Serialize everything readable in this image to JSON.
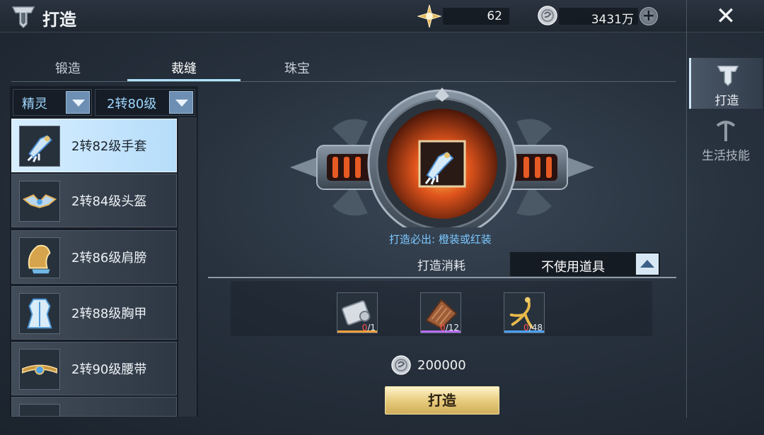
{
  "header": {
    "title": "打造",
    "star_value": "62",
    "silver_value": "3431万"
  },
  "tabs": [
    {
      "label": "锻造"
    },
    {
      "label": "裁缝"
    },
    {
      "label": "珠宝"
    }
  ],
  "filters": {
    "class_label": "精灵",
    "level_label": "2转80级"
  },
  "items": [
    {
      "label": "2转82级手套",
      "icon": "gloves-icon"
    },
    {
      "label": "2转84级头盔",
      "icon": "helmet-icon"
    },
    {
      "label": "2转86级肩膀",
      "icon": "shoulder-icon"
    },
    {
      "label": "2转88级胸甲",
      "icon": "chest-armor-icon"
    },
    {
      "label": "2转90级腰带",
      "icon": "belt-icon"
    }
  ],
  "side_nav": [
    {
      "label": "打造"
    },
    {
      "label": "生活技能"
    }
  ],
  "forge": {
    "note": "打造必出: 橙装或红装",
    "cost_label": "打造消耗",
    "item_select": "不使用道具",
    "materials": [
      {
        "icon": "scroll-icon",
        "owned": "0",
        "needed": "/1",
        "rarity_color": "#f2a03a"
      },
      {
        "icon": "leather-icon",
        "owned": "0",
        "needed": "/12",
        "rarity_color": "#b86cf0"
      },
      {
        "icon": "ginseng-icon",
        "owned": "0",
        "needed": "/48",
        "rarity_color": "#4aa0f0"
      }
    ],
    "silver_cost": "200000",
    "button_label": "打造"
  },
  "colors": {
    "accent": "#aee3ff",
    "note_blue": "#7cc8ff",
    "button_gold": "#e6c97a"
  }
}
